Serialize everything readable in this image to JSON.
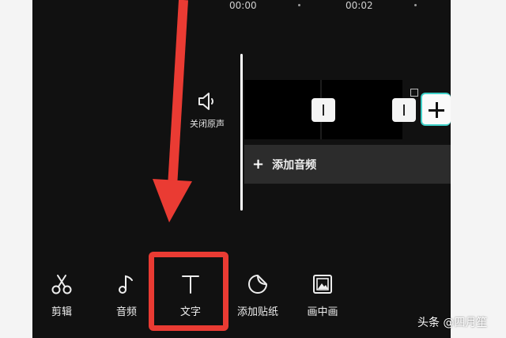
{
  "timeline": {
    "time_marks": [
      "00:00",
      "00:02"
    ]
  },
  "mute_toggle": {
    "label": "关闭原声",
    "icon": "speaker-icon"
  },
  "audio_track": {
    "add_label": "添加音频",
    "plus_glyph": "+"
  },
  "toolbar": {
    "items": [
      {
        "label": "剪辑",
        "icon": "scissors-icon"
      },
      {
        "label": "音频",
        "icon": "music-note-icon"
      },
      {
        "label": "文字",
        "icon": "text-t-icon"
      },
      {
        "label": "添加贴纸",
        "icon": "sticker-icon"
      },
      {
        "label": "画中画",
        "icon": "picture-in-picture-icon"
      }
    ]
  },
  "annotation": {
    "color": "#ea3b33"
  },
  "watermark": {
    "text": "头条 @四月笙"
  },
  "colors": {
    "background": "#111111",
    "accent_border": "#3fd0c8",
    "audio_row": "#2c2c2c"
  }
}
